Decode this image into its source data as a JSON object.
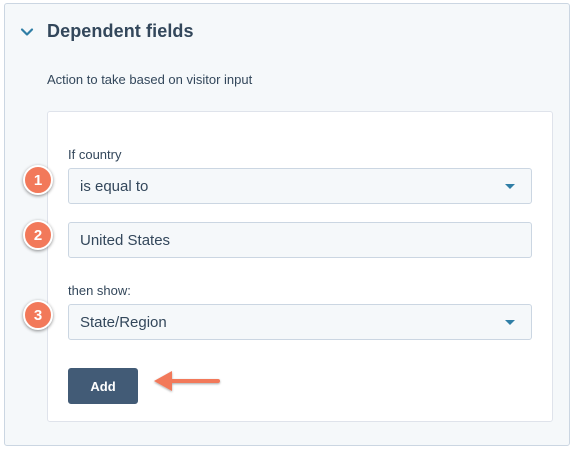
{
  "section": {
    "title": "Dependent fields",
    "description": "Action to take based on visitor input"
  },
  "rule": {
    "condition_label": "If country",
    "operator_value": "is equal to",
    "value_input": "United States",
    "then_label": "then show:",
    "show_field_value": "State/Region"
  },
  "buttons": {
    "add_label": "Add"
  },
  "annotations": {
    "badges": [
      "1",
      "2",
      "3"
    ],
    "arrow_icon": "arrow-left-icon",
    "badge_color": "#f2795a"
  },
  "colors": {
    "primary_button": "#425b76",
    "accent_caret": "#2f7ea6",
    "text": "#33475b"
  }
}
